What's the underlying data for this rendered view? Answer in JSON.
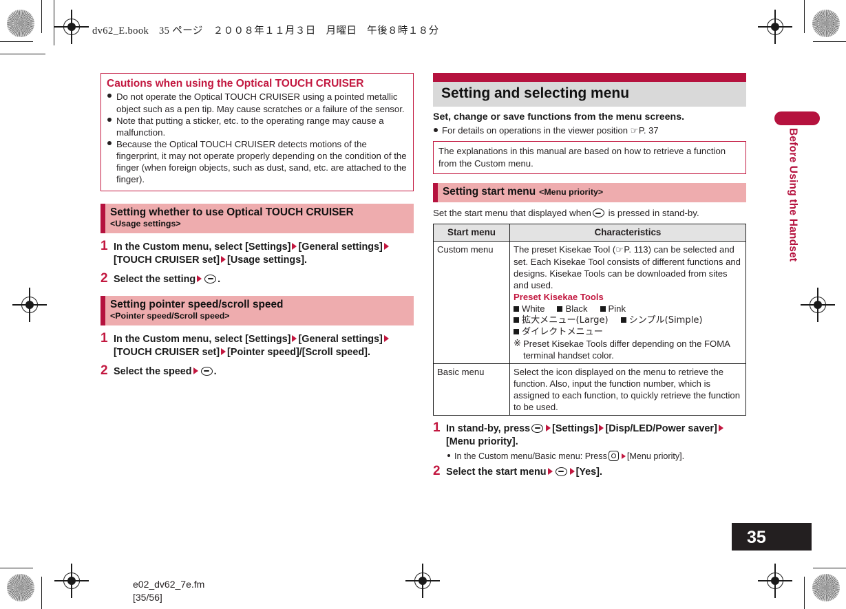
{
  "book_header": "dv62_E.book　35 ページ　２００８年１１月３日　月曜日　午後８時１８分",
  "side_tab": {
    "label": "Before Using the Handset"
  },
  "colors": {
    "accent_red": "#b5123e",
    "title_red": "#c2173f",
    "pink": "#eeacae",
    "banner_gray": "#d9d9d9"
  },
  "left_column": {
    "caution": {
      "title": "Cautions when using the Optical TOUCH CRUISER",
      "items": [
        "Do not operate the Optical TOUCH CRUISER using a pointed metallic object such as a pen tip. May cause scratches or a failure of the sensor.",
        "Note that putting a sticker, etc. to the operating range may cause a malfunction.",
        "Because the Optical TOUCH CRUISER detects motions of the fingerprint, it may not operate properly depending on the condition of the finger (when foreign objects, such as dust, sand, etc. are attached to the finger)."
      ]
    },
    "section1": {
      "title": "Setting whether to use Optical TOUCH CRUISER",
      "subtitle": "<Usage settings>",
      "step1_num": "1",
      "step1_a": "In the Custom menu, select [Settings]",
      "step1_b": "[General settings]",
      "step1_c": "[TOUCH CRUISER set]",
      "step1_d": "[Usage settings].",
      "step2_num": "2",
      "step2_a": "Select the setting",
      "step2_b": "."
    },
    "section2": {
      "title": "Setting pointer speed/scroll speed",
      "subtitle": "<Pointer speed/Scroll speed>",
      "step1_num": "1",
      "step1_a": "In the Custom menu, select [Settings]",
      "step1_b": "[General settings]",
      "step1_c": "[TOUCH CRUISER set]",
      "step1_d": "[Pointer speed]/[Scroll speed].",
      "step2_num": "2",
      "step2_a": "Select the speed",
      "step2_b": "."
    }
  },
  "right_column": {
    "banner_title": "Setting and selecting menu",
    "lead": "Set, change or save functions from the menu screens.",
    "lead_bullet_a": "For details on operations in the viewer position",
    "lead_bullet_ref": "P. 37",
    "note": "The explanations in this manual are based on how to retrieve a function from the Custom menu.",
    "section": {
      "title": "Setting start menu",
      "subtitle": "<Menu priority>"
    },
    "intro_a": "Set the start menu that displayed when",
    "intro_b": "is pressed in stand-by.",
    "table": {
      "headers": [
        "Start menu",
        "Characteristics"
      ],
      "row1": {
        "name": "Custom menu",
        "body_a": "The preset Kisekae Tool (",
        "body_ref": "P. 113",
        "body_b": ") can be selected and set. Each Kisekae Tool consists of different functions and designs. Kisekae Tools can be downloaded from sites and used.",
        "preset_header": "Preset Kisekae Tools",
        "presets_line1": [
          "White",
          "Black",
          "Pink"
        ],
        "presets_line2": [
          "拡大メニュー(Large)",
          "シンプル(Simple)"
        ],
        "presets_line3": [
          "ダイレクトメニュー"
        ],
        "footnote_mark": "※",
        "footnote": "Preset Kisekae Tools differ depending on the FOMA terminal handset color."
      },
      "row2": {
        "name": "Basic menu",
        "body": "Select the icon displayed on the menu to retrieve the function. Also, input the function number, which is assigned to each function, to quickly retrieve the function to be used."
      }
    },
    "steps": {
      "step1_num": "1",
      "step1_a": "In stand-by, press",
      "step1_b": "[Settings]",
      "step1_c": "[Disp/LED/Power saver]",
      "step1_d": "[Menu priority].",
      "substep_a": "In the Custom menu/Basic menu: Press",
      "substep_b": "[Menu priority].",
      "step2_num": "2",
      "step2_a": "Select the start menu",
      "step2_b": "[Yes]."
    }
  },
  "page_number": "35",
  "footer": {
    "file": "e02_dv62_7e.fm",
    "pages": "[35/56]"
  }
}
